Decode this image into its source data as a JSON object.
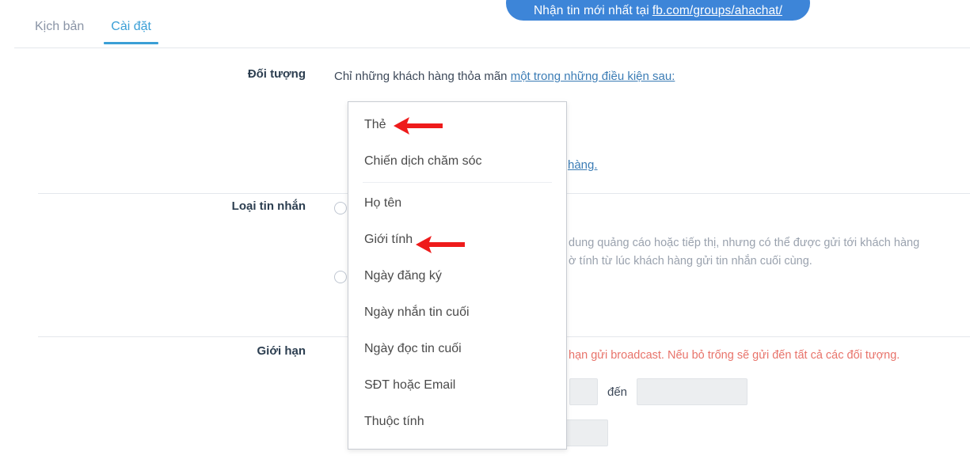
{
  "promo": {
    "text": "Nhận tin mới nhất tại",
    "link": "fb.com/groups/ahachat/",
    "bg_color": "#3d85d8"
  },
  "tabs": [
    {
      "label": "Kịch bản",
      "active": false
    },
    {
      "label": "Cài đặt",
      "active": true
    }
  ],
  "accent_color": "#3a9fd6",
  "rows": {
    "audience": {
      "label": "Đối tượng",
      "text_prefix": "Chỉ những khách hàng thỏa mãn",
      "link_text": "một trong những điều kiện sau:",
      "condition_link_tail": "hàng."
    },
    "message_type": {
      "label": "Loại tin nhắn",
      "helper_line_1": "dung quảng cáo hoặc tiếp thị, nhưng có thể được gửi tới khách hàng",
      "helper_line_2": "ờ tính từ lúc khách hàng gửi tin nhắn cuối cùng."
    },
    "limit": {
      "label": "Giới hạn",
      "alert_text": "hạn gửi broadcast. Nếu bỏ trống sẽ gửi đến tất cả các đối tượng.",
      "range_separator": "đến",
      "from_value": "",
      "to_value": "",
      "bottom_value": ""
    }
  },
  "dropdown": {
    "items": [
      {
        "label": "Thẻ",
        "divider_after": false
      },
      {
        "label": "Chiến dịch chăm sóc",
        "divider_after": true
      },
      {
        "label": "Họ tên",
        "divider_after": false
      },
      {
        "label": "Giới tính",
        "divider_after": false
      },
      {
        "label": "Ngày đăng ký",
        "divider_after": false
      },
      {
        "label": "Ngày nhắn tin cuối",
        "divider_after": false
      },
      {
        "label": "Ngày đọc tin cuối",
        "divider_after": false
      },
      {
        "label": "SĐT hoặc Email",
        "divider_after": false
      },
      {
        "label": "Thuộc tính",
        "divider_after": false
      }
    ]
  },
  "annotations": {
    "arrow_color": "#ee1b1b",
    "arrows": [
      {
        "points_to": "Thẻ"
      },
      {
        "points_to": "Giới tính"
      }
    ]
  }
}
